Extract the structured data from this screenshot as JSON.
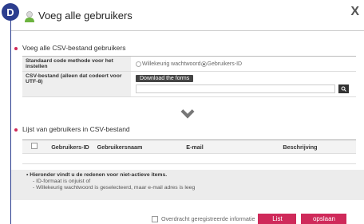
{
  "dialog": {
    "badge": "D",
    "title": "Voeg alle gebruikers",
    "close_glyph": "X"
  },
  "section_csv": {
    "heading": "Voeg alle CSV-bestand gebruikers",
    "code_method_label": "Standaard code methode voor het instellen",
    "radio_random": "Willekeurig wachtwoord",
    "radio_id": "Gebruikers-ID",
    "radio_selected": "Gebruikers-ID",
    "csv_label": "CSV-bestand (alleen dat codeert voor UTF-8)",
    "download_button": "Download the forms",
    "file_value": ""
  },
  "section_list": {
    "heading": "Lijst van gebruikers in CSV-bestand",
    "columns": [
      "Gebruikers-ID",
      "Gebruikersnaam",
      "E-mail",
      "Beschrijving"
    ],
    "rows": []
  },
  "notice": {
    "heading": "Hieronder vindt u de redenen voor niet-actieve items.",
    "lines": [
      "- ID-formaat is onjuist of",
      "- Willekeurig wachtwoord is geselecteerd, maar e-mail adres is leeg"
    ]
  },
  "footer": {
    "checkbox_label": "Overdracht geregistreerde informatie",
    "list_button": "List",
    "save_button": "opslaan"
  },
  "colors": {
    "accent": "#cf2a5a",
    "frame": "#2c3e8f"
  }
}
